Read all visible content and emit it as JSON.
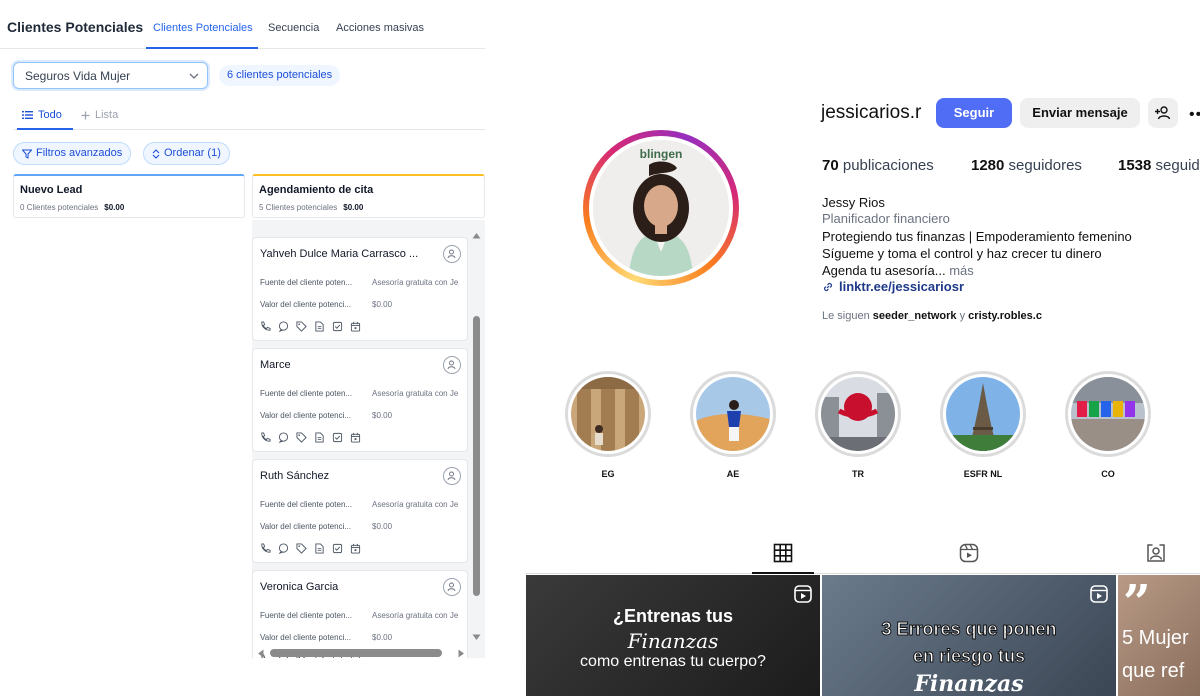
{
  "crm": {
    "title": "Clientes Potenciales",
    "tabs": [
      {
        "label": "Clientes Potenciales",
        "active": true
      },
      {
        "label": "Secuencia",
        "active": false
      },
      {
        "label": "Acciones masivas",
        "active": false
      }
    ],
    "pipeline_select": "Seguros Vida Mujer",
    "leads_count": "6 clientes potenciales",
    "view_tabs": [
      {
        "label": "Todo",
        "active": true,
        "icon": "list-icon"
      },
      {
        "label": "Lista",
        "active": false,
        "icon": "plus-icon"
      }
    ],
    "filters_label": "Filtros avanzados",
    "sort_label": "Ordenar (1)",
    "columns": [
      {
        "name": "Nuevo Lead",
        "count": "0 Clientes potenciales",
        "value": "$0.00",
        "accent": "#60a5fa"
      },
      {
        "name": "Agendamiento de cita",
        "count": "5 Clientes potenciales",
        "value": "$0.00",
        "accent": "#fbbf24"
      }
    ],
    "cards": [
      {
        "name": "Yahveh Dulce Maria Carrasco ...",
        "source_label": "Fuente del cliente poten...",
        "source_value": "Asesoría gratuita con Je",
        "value_label": "Valor del cliente potenci...",
        "value": "$0.00"
      },
      {
        "name": "Marce",
        "source_label": "Fuente del cliente poten...",
        "source_value": "Asesoría gratuita con Je",
        "value_label": "Valor del cliente potenci...",
        "value": "$0.00"
      },
      {
        "name": "Ruth Sánchez",
        "source_label": "Fuente del cliente poten...",
        "source_value": "Asesoría gratuita con Je",
        "value_label": "Valor del cliente potenci...",
        "value": "$0.00"
      },
      {
        "name": "Veronica Garcia",
        "source_label": "Fuente del cliente poten...",
        "source_value": "Asesoría gratuita con Je",
        "value_label": "Valor del cliente potenci...",
        "value": "$0.00"
      }
    ],
    "card_icons": [
      "phone-icon",
      "chat-icon",
      "tag-icon",
      "document-icon",
      "task-icon",
      "calendar-icon"
    ]
  },
  "instagram": {
    "username": "jessicarios.r",
    "follow_label": "Seguir",
    "message_label": "Enviar mensaje",
    "more_label": "•••",
    "avatar_badge": "blingen",
    "stats": [
      {
        "value": "70",
        "label": "publicaciones"
      },
      {
        "value": "1280",
        "label": "seguidores"
      },
      {
        "value": "1538",
        "label": "seguidos"
      }
    ],
    "full_name": "Jessy Rios",
    "category": "Planificador financiero",
    "bio_lines": [
      "Protegiendo tus finanzas | Empoderamiento femenino",
      "Sígueme y toma el control y haz crecer tu dinero",
      "Agenda tu asesoría..."
    ],
    "more_text": "más",
    "link": "linktr.ee/jessicariosr",
    "followed_by_prefix": "Le siguen",
    "followed_by_1": "seeder_network",
    "followed_by_joiner": "y",
    "followed_by_2": "cristy.robles.c",
    "highlights": [
      {
        "label": "EG"
      },
      {
        "label": "AE"
      },
      {
        "label": "TR"
      },
      {
        "label": "ESFR NL"
      },
      {
        "label": "CO"
      }
    ],
    "tabs": [
      "grid-icon",
      "reels-icon",
      "tagged-icon"
    ],
    "posts": [
      {
        "line1": "¿Entrenas tus",
        "line2": "Finanzas",
        "line3": "como entrenas tu cuerpo?"
      },
      {
        "line1": "3 Errores que ponen",
        "line2": "en riesgo tus",
        "line3": "Finanzas"
      },
      {
        "line1": "5 Mujer",
        "line2": "que ref"
      }
    ],
    "colors": {
      "follow": "#4f6df5",
      "link": "#1e3a8a"
    }
  }
}
